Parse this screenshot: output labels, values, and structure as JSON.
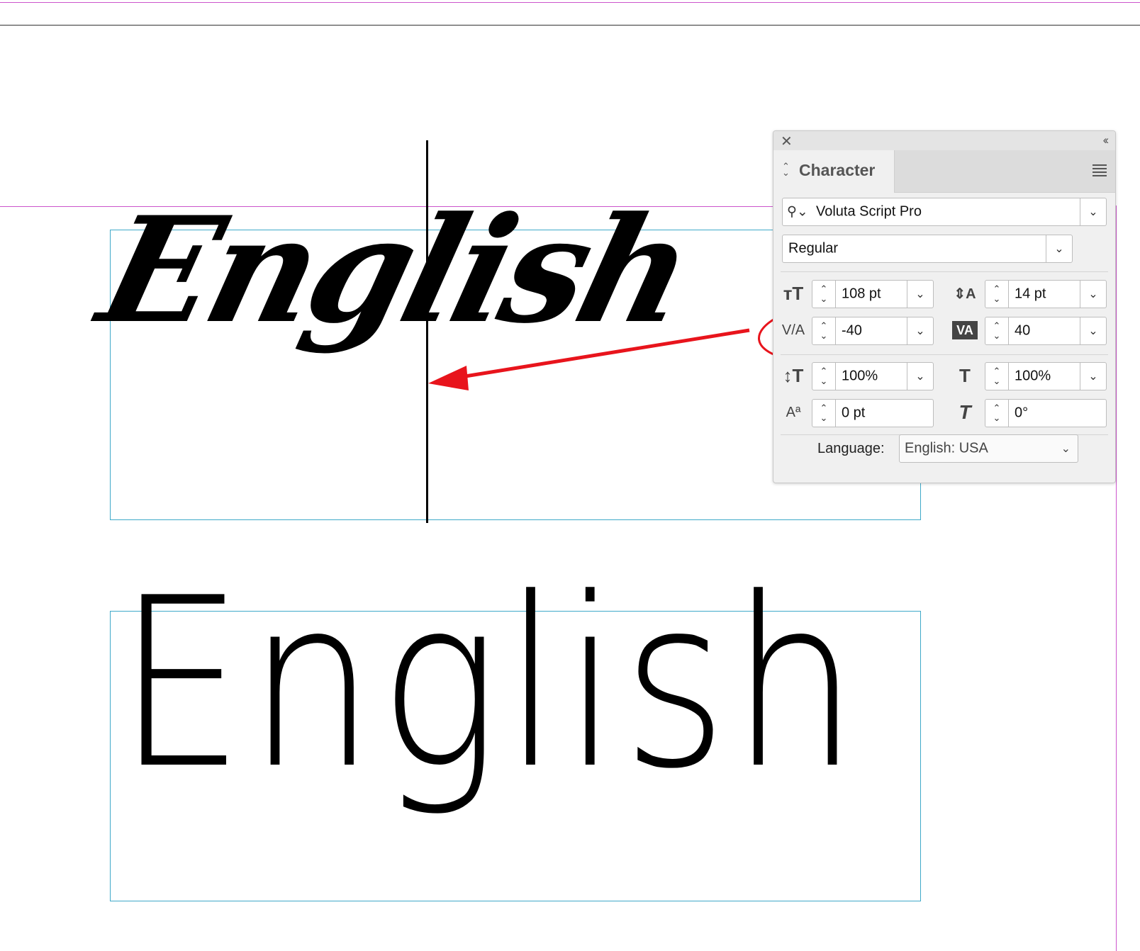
{
  "canvas": {
    "sample_word_top": "English",
    "sample_word_bottom": "English",
    "guide_color": "#cc55cc",
    "frame_color": "#3fa9c9",
    "annotation_color": "#e8141c"
  },
  "panel": {
    "title": "Character",
    "font_family": "Voluta Script Pro",
    "font_style": "Regular",
    "font_size": "108 pt",
    "leading": "14 pt",
    "kerning": "-40",
    "tracking": "40",
    "vertical_scale": "100%",
    "horizontal_scale": "100%",
    "baseline_shift": "0 pt",
    "skew": "0°",
    "language_label": "Language:",
    "language_value": "English: USA"
  },
  "icons": {
    "close": "close-icon",
    "collapse": "double-chevron-left-icon",
    "menu": "hamburger-menu-icon",
    "search": "search-icon",
    "dropdown": "chevron-down-icon"
  }
}
